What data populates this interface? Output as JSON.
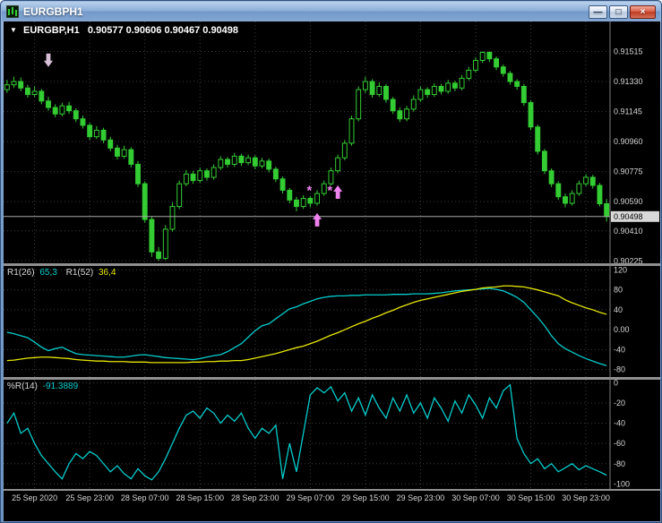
{
  "window": {
    "title": "EURGBPH1",
    "icon": "candlestick-chart-icon",
    "controls": [
      {
        "name": "minimize",
        "glyph": "—"
      },
      {
        "name": "restore",
        "glyph": "□"
      },
      {
        "name": "close",
        "glyph": "×"
      }
    ]
  },
  "icons": {
    "dropdown": "▼"
  },
  "main_chart_header": {
    "symbol_period": "EURGBP,H1",
    "ohlc_text": "0.90577 0.90606 0.90467 0.90498"
  },
  "rsi_header": {
    "label1": "R1(26)",
    "value1": "65,3",
    "label2": "R1(52)",
    "value2": "36,4"
  },
  "wpr_header": {
    "label": "%R(14)",
    "value": "-91.3889"
  },
  "colors": {
    "background": "#000000",
    "grid": "#3d3d3d",
    "candle": "#33cc33",
    "axis_text": "#d6d6d6",
    "separator": "#909090",
    "bid_line": "#a8a8a8",
    "price_tag_bg": "#d8d8d8",
    "price_tag_text": "#000000",
    "rsi_fast": "#00cccc",
    "rsi_slow": "#e6e600",
    "wpr": "#00cccc",
    "marker_up": "#ee82ee",
    "marker_down": "#d8bfd8"
  },
  "chart_data": [
    {
      "type": "candlestick",
      "symbol": "EURGBP",
      "timeframe": "H1",
      "ohlc_current": {
        "open": 0.90577,
        "high": 0.90606,
        "low": 0.90467,
        "close": 0.90498
      },
      "current_price": 0.90498,
      "current_price_label": "0.90498",
      "ylim": [
        0.9021,
        0.917
      ],
      "y_tick_labels": [
        "0.91515",
        "0.91330",
        "0.91145",
        "0.90960",
        "0.90775",
        "0.90590",
        "0.90410",
        "0.90225"
      ],
      "x_tick_labels": [
        "25 Sep 2020",
        "25 Sep 23:00",
        "28 Sep 07:00",
        "28 Sep 15:00",
        "28 Sep 23:00",
        "29 Sep 07:00",
        "29 Sep 15:00",
        "29 Sep 23:00",
        "30 Sep 07:00",
        "30 Sep 15:00",
        "30 Sep 23:00"
      ],
      "x_tick_bars": [
        4,
        12,
        20,
        28,
        36,
        44,
        52,
        60,
        68,
        76,
        84
      ],
      "candles": [
        [
          0.9128,
          0.9134,
          0.9126,
          0.9131
        ],
        [
          0.9131,
          0.9136,
          0.9129,
          0.9133
        ],
        [
          0.9133,
          0.91355,
          0.9127,
          0.9129
        ],
        [
          0.9129,
          0.9131,
          0.9123,
          0.9125
        ],
        [
          0.9125,
          0.913,
          0.91235,
          0.9127
        ],
        [
          0.9127,
          0.91285,
          0.9119,
          0.9121
        ],
        [
          0.9121,
          0.91235,
          0.9115,
          0.9117
        ],
        [
          0.9117,
          0.9119,
          0.9111,
          0.9113
        ],
        [
          0.9113,
          0.912,
          0.91115,
          0.9118
        ],
        [
          0.9118,
          0.91205,
          0.9113,
          0.9115
        ],
        [
          0.9115,
          0.91165,
          0.9108,
          0.911
        ],
        [
          0.911,
          0.9112,
          0.9104,
          0.9106
        ],
        [
          0.9106,
          0.91075,
          0.9097,
          0.9099
        ],
        [
          0.9099,
          0.91055,
          0.90975,
          0.9103
        ],
        [
          0.9103,
          0.91045,
          0.9095,
          0.9097
        ],
        [
          0.9097,
          0.9099,
          0.909,
          0.9092
        ],
        [
          0.9092,
          0.9094,
          0.9085,
          0.9087
        ],
        [
          0.9087,
          0.90935,
          0.90855,
          0.9091
        ],
        [
          0.9091,
          0.90925,
          0.908,
          0.9082
        ],
        [
          0.9082,
          0.9084,
          0.9068,
          0.907
        ],
        [
          0.907,
          0.90715,
          0.9046,
          0.9048
        ],
        [
          0.9048,
          0.905,
          0.9025,
          0.9028
        ],
        [
          0.9028,
          0.9031,
          0.90225,
          0.9024
        ],
        [
          0.9024,
          0.90445,
          0.9023,
          0.9042
        ],
        [
          0.9042,
          0.90585,
          0.90405,
          0.9056
        ],
        [
          0.9056,
          0.9072,
          0.90545,
          0.907
        ],
        [
          0.907,
          0.90785,
          0.90685,
          0.9076
        ],
        [
          0.9076,
          0.9078,
          0.907,
          0.9072
        ],
        [
          0.9072,
          0.908,
          0.90705,
          0.9078
        ],
        [
          0.9078,
          0.90795,
          0.9072,
          0.9074
        ],
        [
          0.9074,
          0.9082,
          0.90725,
          0.908
        ],
        [
          0.908,
          0.9087,
          0.90785,
          0.9085
        ],
        [
          0.9085,
          0.90865,
          0.908,
          0.9082
        ],
        [
          0.9082,
          0.9089,
          0.90805,
          0.9087
        ],
        [
          0.9087,
          0.90885,
          0.9081,
          0.9083
        ],
        [
          0.9083,
          0.9088,
          0.90815,
          0.9086
        ],
        [
          0.9086,
          0.90875,
          0.9079,
          0.9081
        ],
        [
          0.9081,
          0.9086,
          0.90795,
          0.9084
        ],
        [
          0.9084,
          0.90855,
          0.9077,
          0.9079
        ],
        [
          0.9079,
          0.90805,
          0.9071,
          0.9073
        ],
        [
          0.9073,
          0.90745,
          0.9064,
          0.9066
        ],
        [
          0.9066,
          0.90675,
          0.9058,
          0.906
        ],
        [
          0.906,
          0.9062,
          0.9053,
          0.9056
        ],
        [
          0.9056,
          0.9063,
          0.90545,
          0.9061
        ],
        [
          0.9061,
          0.90625,
          0.90555,
          0.9058
        ],
        [
          0.9058,
          0.9066,
          0.90565,
          0.9064
        ],
        [
          0.9064,
          0.9072,
          0.90625,
          0.907
        ],
        [
          0.907,
          0.908,
          0.9069,
          0.9078
        ],
        [
          0.9078,
          0.9088,
          0.90765,
          0.9086
        ],
        [
          0.9086,
          0.9097,
          0.90845,
          0.9095
        ],
        [
          0.9095,
          0.9112,
          0.90935,
          0.911
        ],
        [
          0.911,
          0.913,
          0.91085,
          0.9128
        ],
        [
          0.9128,
          0.9136,
          0.9126,
          0.9133
        ],
        [
          0.9133,
          0.91345,
          0.9123,
          0.9125
        ],
        [
          0.9125,
          0.91325,
          0.91235,
          0.913
        ],
        [
          0.913,
          0.91315,
          0.912,
          0.9122
        ],
        [
          0.9122,
          0.91235,
          0.9113,
          0.9115
        ],
        [
          0.9115,
          0.9117,
          0.9108,
          0.911
        ],
        [
          0.911,
          0.9118,
          0.91085,
          0.9116
        ],
        [
          0.9116,
          0.91245,
          0.91145,
          0.9122
        ],
        [
          0.9122,
          0.913,
          0.91205,
          0.9128
        ],
        [
          0.9128,
          0.91295,
          0.9123,
          0.9125
        ],
        [
          0.9125,
          0.9132,
          0.91235,
          0.913
        ],
        [
          0.913,
          0.91315,
          0.9125,
          0.9127
        ],
        [
          0.9127,
          0.9134,
          0.91255,
          0.9132
        ],
        [
          0.9132,
          0.91335,
          0.9127,
          0.9129
        ],
        [
          0.9129,
          0.9137,
          0.91275,
          0.9135
        ],
        [
          0.9135,
          0.9142,
          0.91335,
          0.914
        ],
        [
          0.914,
          0.9148,
          0.91385,
          0.9146
        ],
        [
          0.9146,
          0.91515,
          0.91445,
          0.9151
        ],
        [
          0.9151,
          0.91515,
          0.9145,
          0.9147
        ],
        [
          0.9147,
          0.91485,
          0.914,
          0.9142
        ],
        [
          0.9142,
          0.91435,
          0.9136,
          0.9138
        ],
        [
          0.9138,
          0.91395,
          0.9131,
          0.9133
        ],
        [
          0.9133,
          0.91345,
          0.9128,
          0.913
        ],
        [
          0.913,
          0.91315,
          0.9118,
          0.912
        ],
        [
          0.912,
          0.91215,
          0.9103,
          0.9105
        ],
        [
          0.9105,
          0.91065,
          0.9088,
          0.909
        ],
        [
          0.909,
          0.90915,
          0.9076,
          0.9078
        ],
        [
          0.9078,
          0.90795,
          0.9068,
          0.907
        ],
        [
          0.907,
          0.90715,
          0.906,
          0.9062
        ],
        [
          0.9062,
          0.9064,
          0.90555,
          0.9058
        ],
        [
          0.9058,
          0.9066,
          0.90565,
          0.9064
        ],
        [
          0.9064,
          0.9072,
          0.90625,
          0.907
        ],
        [
          0.907,
          0.9076,
          0.90685,
          0.9074
        ],
        [
          0.9074,
          0.90755,
          0.9067,
          0.9069
        ],
        [
          0.9069,
          0.90705,
          0.9056,
          0.90577
        ],
        [
          0.90577,
          0.90606,
          0.90467,
          0.90498
        ]
      ],
      "markers": [
        {
          "shape": "arrow-down",
          "bar": 6,
          "price": 0.9142,
          "color_key": "marker_down"
        },
        {
          "shape": "asterisk",
          "bar": 44,
          "price": 0.9066,
          "color_key": "marker_up"
        },
        {
          "shape": "arrow-up",
          "bar": 45,
          "price": 0.9052,
          "color_key": "marker_up"
        },
        {
          "shape": "asterisk",
          "bar": 47,
          "price": 0.9066,
          "color_key": "marker_up"
        },
        {
          "shape": "arrow-up",
          "bar": 48,
          "price": 0.9069,
          "color_key": "marker_up"
        }
      ]
    },
    {
      "type": "line",
      "name": "R1 oscillator",
      "ylim": [
        -95,
        128
      ],
      "y_tick_labels": [
        "120",
        "80",
        "40",
        "0.00",
        "-40",
        "-80"
      ],
      "series": [
        {
          "name": "R1(26)",
          "current": "65,3",
          "color_key": "rsi_fast",
          "values": [
            -5,
            -8,
            -12,
            -16,
            -25,
            -35,
            -42,
            -38,
            -35,
            -42,
            -48,
            -50,
            -51,
            -52,
            -53,
            -54,
            -55,
            -55,
            -53,
            -51,
            -50,
            -52,
            -54,
            -56,
            -57,
            -58,
            -59,
            -60,
            -58,
            -55,
            -52,
            -50,
            -44,
            -36,
            -28,
            -15,
            -2,
            8,
            12,
            22,
            32,
            42,
            46,
            52,
            57,
            62,
            65,
            67,
            68,
            68,
            69,
            69,
            70,
            70,
            70,
            70,
            71,
            71,
            71,
            72,
            72,
            72,
            73,
            74,
            76,
            78,
            79,
            80,
            81,
            82,
            83,
            81,
            78,
            72,
            65,
            55,
            40,
            25,
            8,
            -12,
            -28,
            -38,
            -45,
            -52,
            -58,
            -63,
            -68,
            -72
          ]
        },
        {
          "name": "R1(52)",
          "current": "36,4",
          "color_key": "rsi_slow",
          "values": [
            -62,
            -61,
            -59,
            -57,
            -56,
            -55,
            -55,
            -56,
            -57,
            -58,
            -60,
            -61,
            -62,
            -63,
            -63,
            -64,
            -64,
            -64,
            -65,
            -65,
            -65,
            -66,
            -66,
            -66,
            -66,
            -66,
            -66,
            -65,
            -65,
            -64,
            -64,
            -63,
            -63,
            -62,
            -62,
            -60,
            -57,
            -54,
            -51,
            -48,
            -44,
            -40,
            -36,
            -33,
            -28,
            -23,
            -17,
            -11,
            -6,
            0,
            6,
            12,
            17,
            23,
            28,
            34,
            39,
            45,
            50,
            55,
            59,
            62,
            65,
            68,
            71,
            74,
            77,
            79,
            81,
            84,
            85,
            86,
            88,
            88,
            87,
            86,
            83,
            80,
            76,
            72,
            68,
            60,
            54,
            49,
            44,
            40,
            35,
            31
          ]
        }
      ]
    },
    {
      "type": "line",
      "name": "Williams Percent Range",
      "ylim": [
        -105,
        3
      ],
      "y_tick_labels": [
        "0",
        "-20",
        "-40",
        "-60",
        "-80",
        "-100"
      ],
      "series": [
        {
          "name": "%R(14)",
          "current": "-91.3889",
          "color_key": "wpr",
          "values": [
            -40,
            -30,
            -50,
            -45,
            -60,
            -72,
            -80,
            -88,
            -95,
            -80,
            -70,
            -75,
            -68,
            -72,
            -80,
            -88,
            -82,
            -90,
            -95,
            -85,
            -92,
            -96,
            -88,
            -75,
            -60,
            -45,
            -32,
            -28,
            -35,
            -25,
            -30,
            -40,
            -32,
            -38,
            -30,
            -45,
            -55,
            -45,
            -50,
            -42,
            -95,
            -60,
            -88,
            -50,
            -12,
            -5,
            -10,
            -4,
            -18,
            -10,
            -28,
            -15,
            -32,
            -12,
            -25,
            -35,
            -15,
            -28,
            -12,
            -30,
            -20,
            -35,
            -15,
            -25,
            -38,
            -18,
            -30,
            -12,
            -22,
            -35,
            -15,
            -25,
            -8,
            -2,
            -55,
            -70,
            -80,
            -75,
            -85,
            -80,
            -88,
            -84,
            -80,
            -86,
            -82,
            -85,
            -88,
            -91.39
          ]
        }
      ]
    }
  ]
}
